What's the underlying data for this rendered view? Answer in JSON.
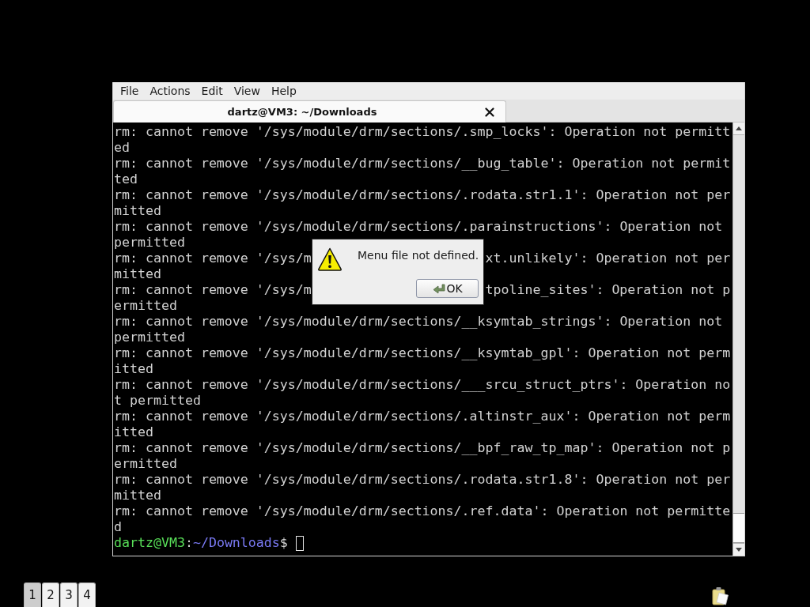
{
  "window": {
    "menu": [
      "File",
      "Actions",
      "Edit",
      "View",
      "Help"
    ]
  },
  "tabs": [
    {
      "title": "dartz@VM3: ~/Downloads",
      "selected": true
    }
  ],
  "terminal": {
    "rows": [
      {
        "kind": "line",
        "text": "rm: cannot remove '/sys/module/drm/sections/.smp_locks': Operation not permitt"
      },
      {
        "kind": "line",
        "text": "ed"
      },
      {
        "kind": "line",
        "text": "rm: cannot remove '/sys/module/drm/sections/__bug_table': Operation not permit"
      },
      {
        "kind": "line",
        "text": "ted"
      },
      {
        "kind": "line",
        "text": "rm: cannot remove '/sys/module/drm/sections/.rodata.str1.1': Operation not per"
      },
      {
        "kind": "line",
        "text": "mitted"
      },
      {
        "kind": "line",
        "text": "rm: cannot remove '/sys/module/drm/sections/.parainstructions': Operation not"
      },
      {
        "kind": "line",
        "text": "permitted"
      },
      {
        "kind": "split",
        "left": "rm: cannot remove '/sys/m",
        "right": "xt.unlikely': Operation not per"
      },
      {
        "kind": "line",
        "text": "mitted"
      },
      {
        "kind": "split",
        "left": "rm: cannot remove '/sys/m",
        "right": "tpoline_sites': Operation not p"
      },
      {
        "kind": "line",
        "text": "ermitted"
      },
      {
        "kind": "line",
        "text": "rm: cannot remove '/sys/module/drm/sections/__ksymtab_strings': Operation not"
      },
      {
        "kind": "line",
        "text": "permitted"
      },
      {
        "kind": "line",
        "text": "rm: cannot remove '/sys/module/drm/sections/__ksymtab_gpl': Operation not perm"
      },
      {
        "kind": "line",
        "text": "itted"
      },
      {
        "kind": "line",
        "text": "rm: cannot remove '/sys/module/drm/sections/___srcu_struct_ptrs': Operation no"
      },
      {
        "kind": "line",
        "text": "t permitted"
      },
      {
        "kind": "line",
        "text": "rm: cannot remove '/sys/module/drm/sections/.altinstr_aux': Operation not perm"
      },
      {
        "kind": "line",
        "text": "itted"
      },
      {
        "kind": "line",
        "text": "rm: cannot remove '/sys/module/drm/sections/__bpf_raw_tp_map': Operation not p"
      },
      {
        "kind": "line",
        "text": "ermitted"
      },
      {
        "kind": "line",
        "text": "rm: cannot remove '/sys/module/drm/sections/.rodata.str1.8': Operation not per"
      },
      {
        "kind": "line",
        "text": "mitted"
      },
      {
        "kind": "line",
        "text": "rm: cannot remove '/sys/module/drm/sections/.ref.data': Operation not permitte"
      },
      {
        "kind": "line",
        "text": "d"
      }
    ],
    "prompt": {
      "user_host": "dartz@VM3",
      "separator": ":",
      "path": "~/Downloads",
      "symbol": "$"
    }
  },
  "dialog": {
    "message": "Menu file not defined.",
    "button": "OK"
  },
  "panel": {
    "workspaces": [
      {
        "label": "1",
        "selected": true
      },
      {
        "label": "2",
        "selected": false
      },
      {
        "label": "3",
        "selected": false
      },
      {
        "label": "4",
        "selected": false
      }
    ]
  }
}
